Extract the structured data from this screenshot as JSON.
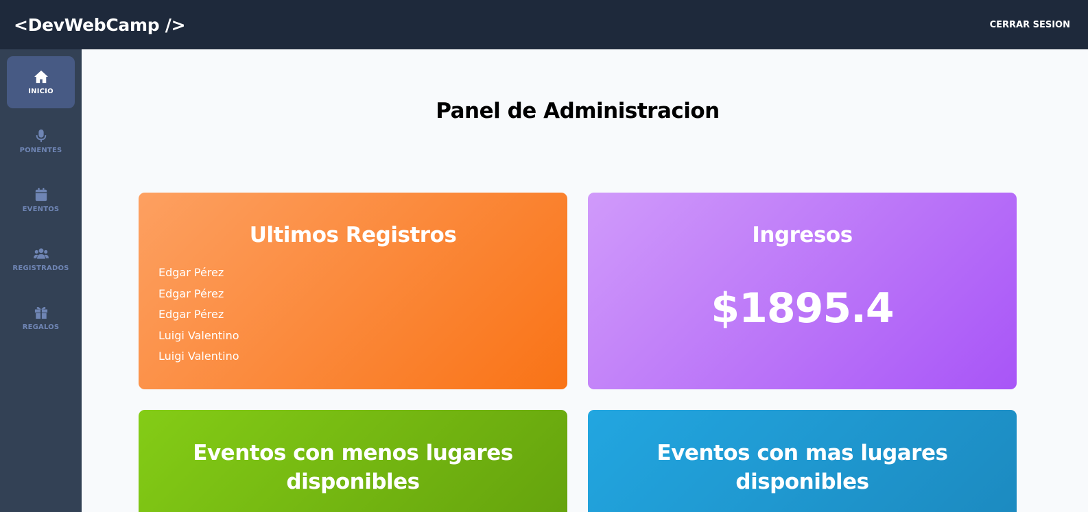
{
  "header": {
    "logo": "<DevWebCamp />",
    "logout_label": "CERRAR SESION"
  },
  "sidebar": {
    "items": [
      {
        "label": "INICIO",
        "icon": "home-icon",
        "active": true
      },
      {
        "label": "PONENTES",
        "icon": "microphone-icon",
        "active": false
      },
      {
        "label": "EVENTOS",
        "icon": "calendar-icon",
        "active": false
      },
      {
        "label": "REGISTRADOS",
        "icon": "users-icon",
        "active": false
      },
      {
        "label": "REGALOS",
        "icon": "gift-icon",
        "active": false
      }
    ]
  },
  "main": {
    "title": "Panel de Administracion",
    "registros": {
      "title": "Ultimos Registros",
      "names": [
        "Edgar Pérez",
        "Edgar Pérez",
        "Edgar Pérez",
        "Luigi Valentino",
        "Luigi Valentino"
      ]
    },
    "ingresos": {
      "title": "Ingresos",
      "amount": "$1895.4"
    },
    "menos_lugares": {
      "title": "Eventos con menos lugares disponibles"
    },
    "mas_lugares": {
      "title": "Eventos con mas lugares disponibles"
    }
  },
  "colors": {
    "topbar": "#1e293b",
    "sidebar": "#334155",
    "active_nav": "#475a84",
    "registros_card": "#f97316",
    "ingresos_card": "#a855f7",
    "menos_card": "#84cc16",
    "mas_card": "#1c8ac0"
  }
}
